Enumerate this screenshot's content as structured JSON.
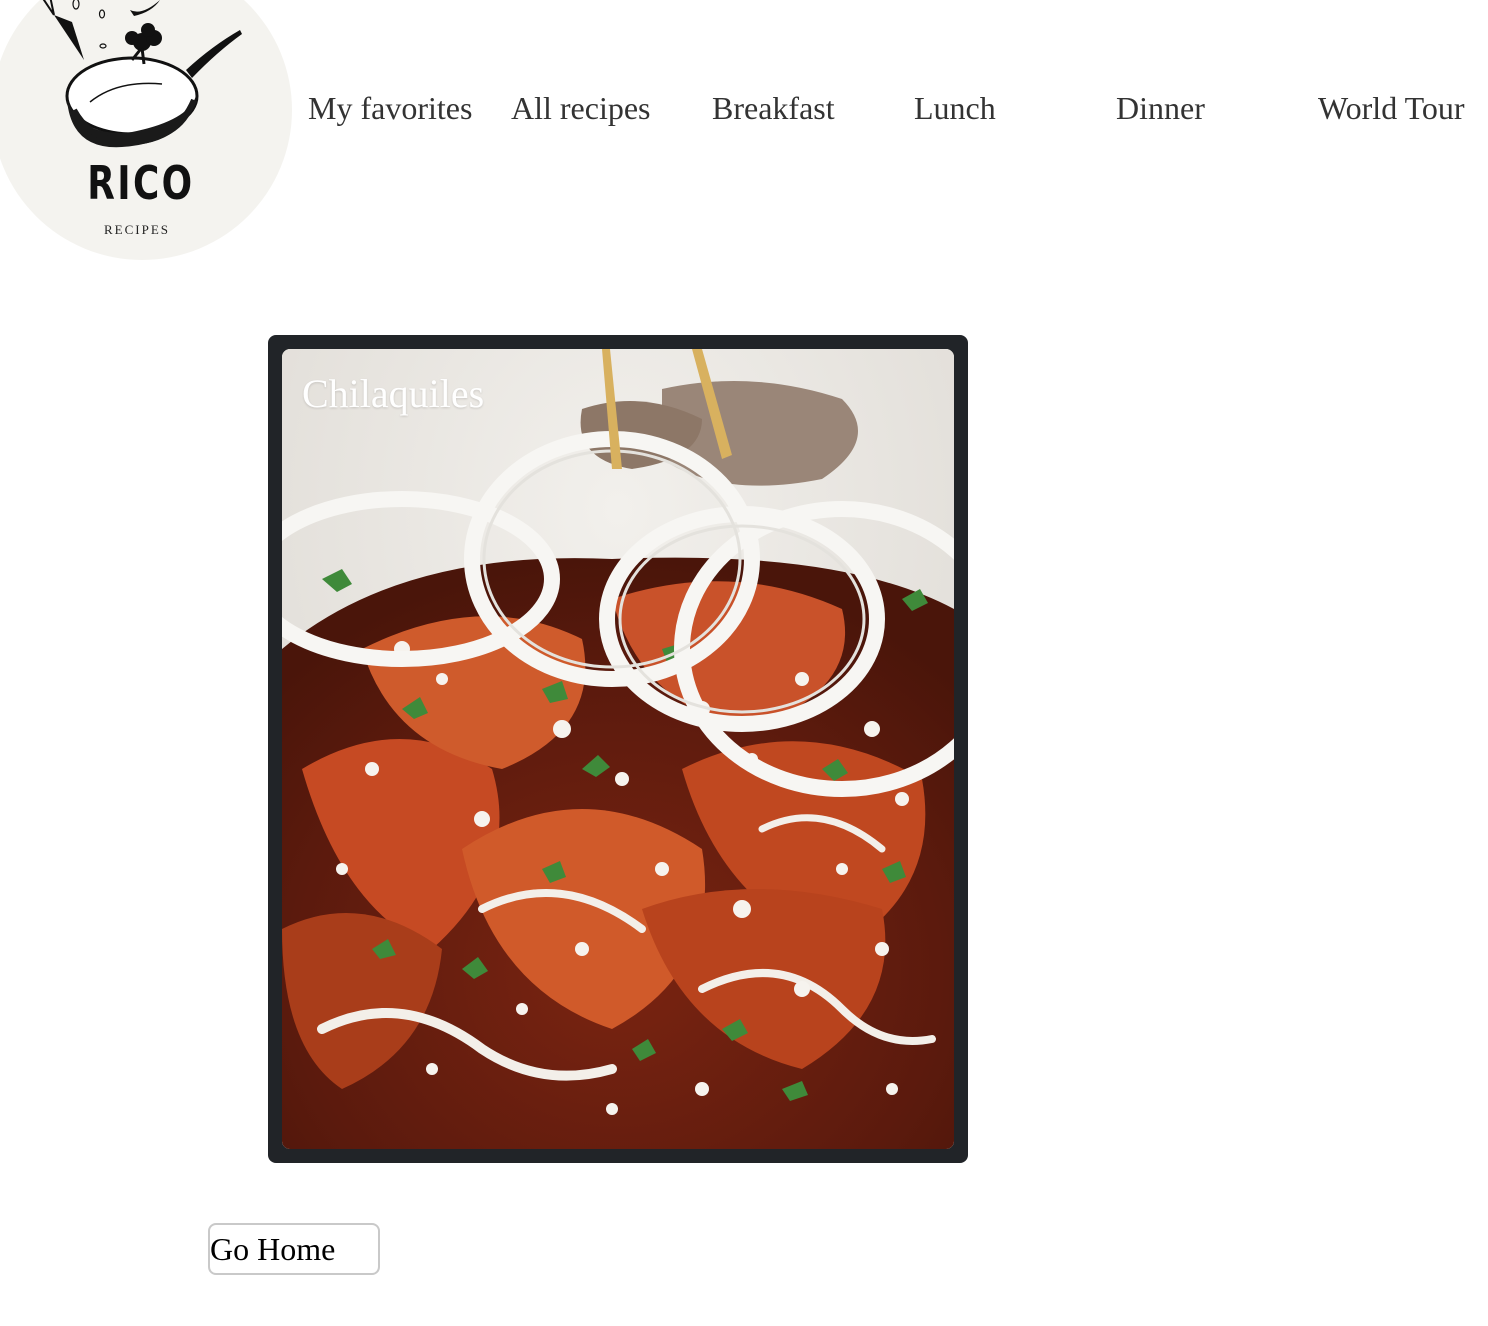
{
  "logo": {
    "word": "RICO",
    "sub": "RECIPES",
    "icon": "pan-with-vegetables-icon"
  },
  "nav": {
    "favorites": "My favorites",
    "all": "All recipes",
    "breakfast": "Breakfast",
    "lunch": "Lunch",
    "dinner": "Dinner",
    "world": "World Tour"
  },
  "recipe": {
    "title": "Chilaquiles"
  },
  "actions": {
    "go_home": "Go Home"
  },
  "colors": {
    "card_frame": "#212428",
    "logo_bg": "#f4f3ef",
    "nav_text": "#333333"
  }
}
